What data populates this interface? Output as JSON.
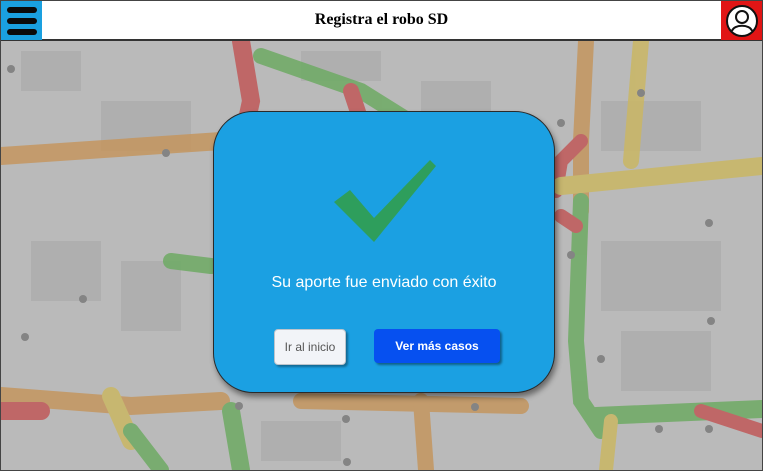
{
  "header": {
    "title": "Registra el robo SD",
    "menu_icon": "hamburger-menu-icon",
    "profile_icon": "user-profile-icon",
    "menu_color": "#1aa0e0",
    "profile_color": "#e11515"
  },
  "map": {
    "traffic_colors": {
      "heavy": "#e24a4a",
      "moderate": "#e8a352",
      "slow": "#f0d45a",
      "clear": "#69c25a"
    }
  },
  "modal": {
    "icon": "checkmark-icon",
    "background_color": "#1ba0e2",
    "message": "Su aporte fue enviado con éxito",
    "home_button_label": "Ir al inicio",
    "more_button_label": "Ver más casos",
    "more_button_color": "#0650f0"
  }
}
